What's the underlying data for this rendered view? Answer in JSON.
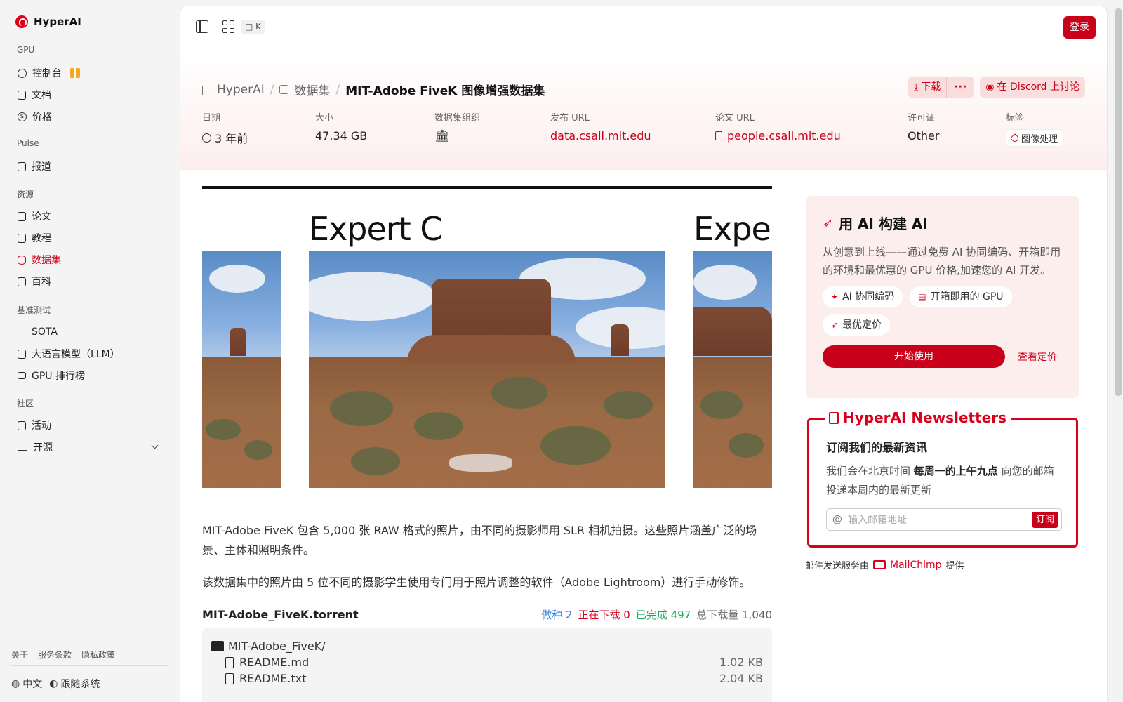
{
  "app": {
    "name": "HyperAI"
  },
  "sidebar": {
    "sections": [
      {
        "title": "GPU",
        "items": [
          {
            "label": "控制台",
            "icon": "dashboard-icon"
          },
          {
            "label": "文档",
            "icon": "doc-icon"
          },
          {
            "label": "价格",
            "icon": "price-icon"
          }
        ]
      },
      {
        "title": "Pulse",
        "items": [
          {
            "label": "报道",
            "icon": "news-icon"
          }
        ]
      },
      {
        "title": "资源",
        "items": [
          {
            "label": "论文",
            "icon": "paper-icon"
          },
          {
            "label": "教程",
            "icon": "tutorial-icon"
          },
          {
            "label": "数据集",
            "icon": "dataset-icon",
            "active": true
          },
          {
            "label": "百科",
            "icon": "wiki-icon"
          }
        ]
      },
      {
        "title": "基准测试",
        "items": [
          {
            "label": "SOTA",
            "icon": "chart-icon"
          },
          {
            "label": "大语言模型（LLM）",
            "icon": "chip-icon"
          },
          {
            "label": "GPU 排行榜",
            "icon": "monitor-icon"
          }
        ]
      },
      {
        "title": "社区",
        "items": [
          {
            "label": "活动",
            "icon": "event-icon"
          },
          {
            "label": "开源",
            "icon": "opensource-icon"
          }
        ]
      }
    ],
    "footer_links": [
      "关于",
      "服务条款",
      "隐私政策"
    ],
    "language": "中文",
    "theme": "跟随系统"
  },
  "topbar": {
    "shortcut": "□ K",
    "login_label": "登录"
  },
  "breadcrumb": {
    "home": "HyperAI",
    "section": "数据集",
    "current": "MIT-Adobe FiveK 图像增强数据集"
  },
  "actions": {
    "download": "下载",
    "more": "···",
    "discord": "在 Discord 上讨论"
  },
  "meta": {
    "date_label": "日期",
    "date_value": "3 年前",
    "size_label": "大小",
    "size_value": "47.34 GB",
    "org_label": "数据集组织",
    "url_label": "发布 URL",
    "url_value": "data.csail.mit.edu",
    "paper_label": "论文 URL",
    "paper_value": "people.csail.mit.edu",
    "license_label": "许可证",
    "license_value": "Other",
    "tags_label": "标签",
    "tag_value": "图像处理"
  },
  "figure": {
    "label_main": "Expert C",
    "label_right": "Expe"
  },
  "description": {
    "p1": "MIT-Adobe FiveK 包含 5,000 张 RAW 格式的照片，由不同的摄影师用 SLR 相机拍摄。这些照片涵盖广泛的场景、主体和照明条件。",
    "p2": "该数据集中的照片由 5 位不同的摄影学生使用专门用于照片调整的软件（Adobe Lightroom）进行手动修饰。"
  },
  "torrent": {
    "name": "MIT-Adobe_FiveK.torrent",
    "seeding_label": "做种",
    "seeding": "2",
    "downloading_label": "正在下载",
    "downloading": "0",
    "completed_label": "已完成",
    "completed": "497",
    "total_label": "总下载量",
    "total": "1,040",
    "files": [
      {
        "name": "MIT-Adobe_FiveK/",
        "type": "folder",
        "size": ""
      },
      {
        "name": "README.md",
        "type": "file",
        "size": "1.02 KB"
      },
      {
        "name": "README.txt",
        "type": "file",
        "size": "2.04 KB"
      }
    ]
  },
  "promo": {
    "title": "用 AI 构建 AI",
    "desc": "从创意到上线——通过免费 AI 协同编码、开箱即用的环境和最优惠的 GPU 价格,加速您的 AI 开发。",
    "chips": [
      "AI 协同编码",
      "开箱即用的 GPU",
      "最优定价"
    ],
    "start": "开始使用",
    "pricing": "查看定价"
  },
  "newsletter": {
    "title": "HyperAI Newsletters",
    "subtitle": "订阅我们的最新资讯",
    "desc_pre": "我们会在北京时间",
    "desc_bold": "每周一的上午九点",
    "desc_post": "向您的邮箱投递本周内的最新更新",
    "placeholder": "输入邮箱地址",
    "button": "订阅",
    "note_pre": "邮件发送服务由",
    "note_link": "MailChimp",
    "note_post": "提供"
  },
  "colors": {
    "accent": "#c8001a",
    "seed": "#2a7de1",
    "done": "#1aa860"
  }
}
